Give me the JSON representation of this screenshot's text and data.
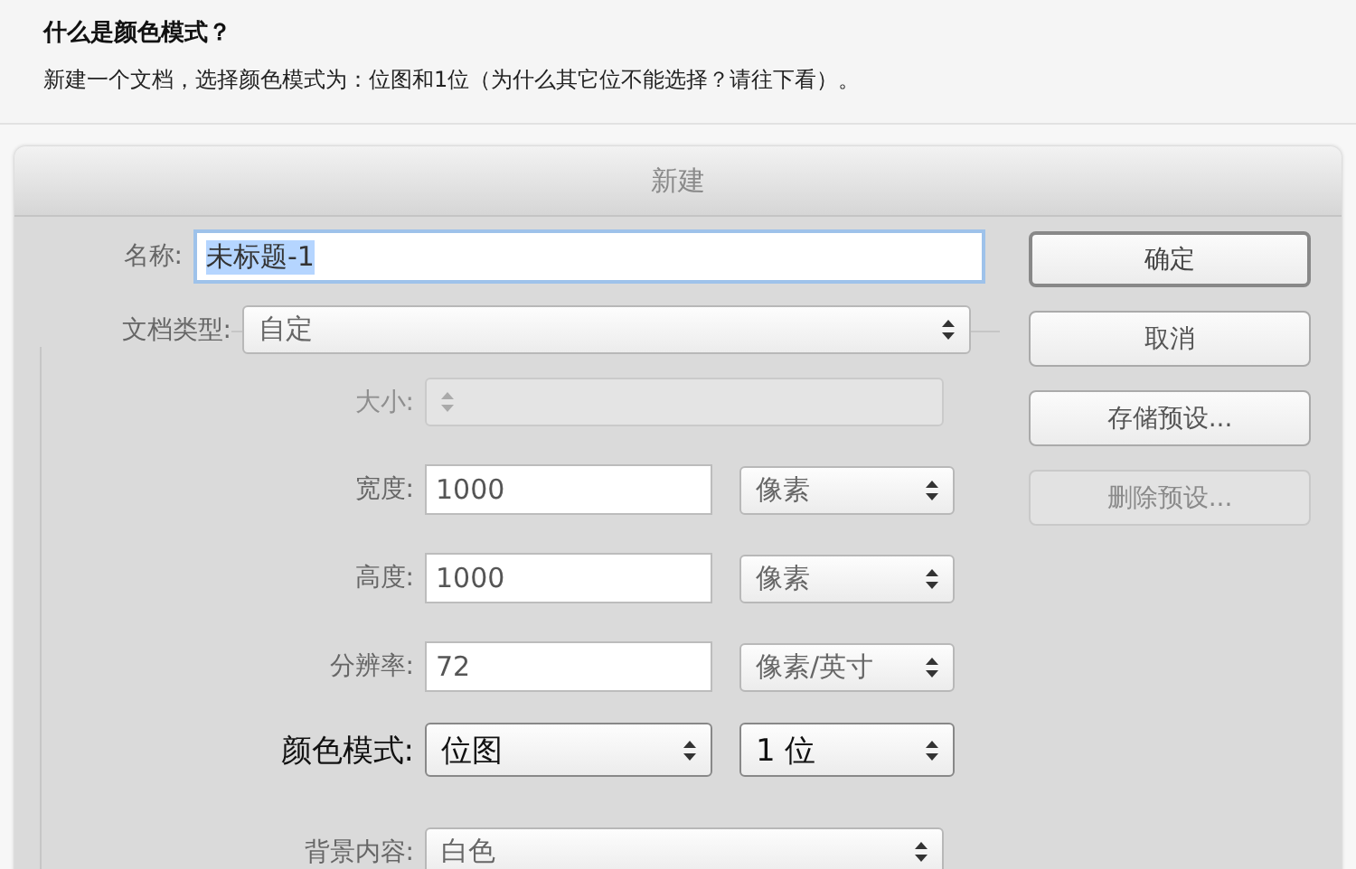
{
  "header": {
    "title": "什么是颜色模式？",
    "description": "新建一个文档，选择颜色模式为：位图和1位（为什么其它位不能选择？请往下看）。"
  },
  "dialog": {
    "title": "新建",
    "name": {
      "label": "名称:",
      "value": "未标题-1",
      "text_selected": true
    },
    "document_type": {
      "label": "文档类型:",
      "value": "自定"
    },
    "settings": [
      {
        "kind": "select",
        "label": "大小:",
        "disabled": true,
        "emphasized": false
      },
      {
        "kind": "input_unit",
        "label": "宽度:",
        "value": "1000",
        "unit": "像素",
        "disabled": false,
        "emphasized": false
      },
      {
        "kind": "input_unit",
        "label": "高度:",
        "value": "1000",
        "unit": "像素",
        "disabled": false,
        "emphasized": false
      },
      {
        "kind": "input_unit",
        "label": "分辨率:",
        "value": "72",
        "unit": "像素/英寸",
        "disabled": false,
        "emphasized": false
      },
      {
        "kind": "select_pair",
        "label": "颜色模式:",
        "value": "位图",
        "unit": "1 位",
        "disabled": false,
        "emphasized": true
      },
      {
        "kind": "select",
        "label": "背景内容:",
        "value": "白色",
        "disabled": false,
        "emphasized": false
      }
    ],
    "buttons": [
      {
        "label": "确定",
        "default": true,
        "disabled": false
      },
      {
        "label": "取消",
        "default": false,
        "disabled": false
      },
      {
        "label": "存储预设...",
        "default": false,
        "disabled": false
      },
      {
        "label": "删除预设...",
        "default": false,
        "disabled": true
      }
    ]
  }
}
